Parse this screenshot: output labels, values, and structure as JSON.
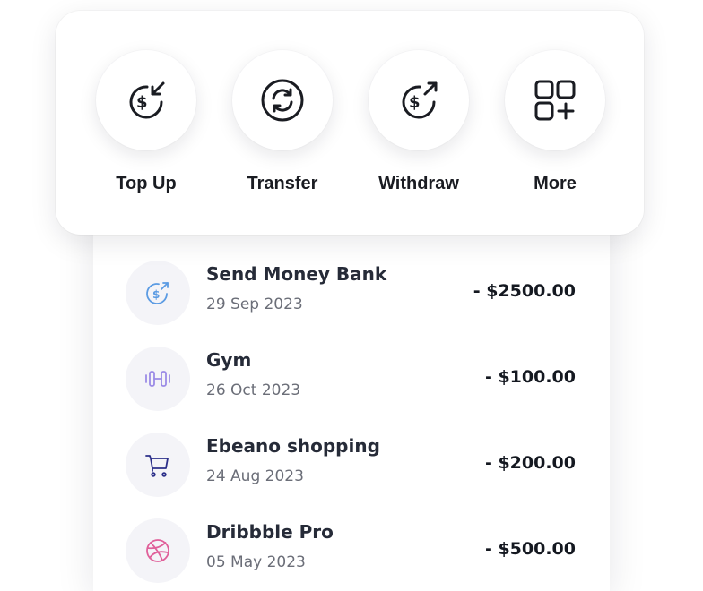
{
  "quick_actions": [
    {
      "label": "Top Up",
      "icon": "dollar-arrow-in-icon"
    },
    {
      "label": "Transfer",
      "icon": "refresh-dollar-icon"
    },
    {
      "label": "Withdraw",
      "icon": "dollar-arrow-out-icon"
    },
    {
      "label": "More",
      "icon": "grid-plus-icon"
    }
  ],
  "transactions": [
    {
      "name": "Send Money Bank",
      "date": "29 Sep 2023",
      "amount": "- $2500.00",
      "icon": "send-money-icon",
      "icon_color": "#5b9be3"
    },
    {
      "name": "Gym",
      "date": "26 Oct 2023",
      "amount": "- $100.00",
      "icon": "dumbbell-icon",
      "icon_color": "#9b8be6"
    },
    {
      "name": "Ebeano shopping",
      "date": "24 Aug 2023",
      "amount": "- $200.00",
      "icon": "shopping-cart-icon",
      "icon_color": "#2c2f8a"
    },
    {
      "name": "Dribbble Pro",
      "date": "05 May 2023",
      "amount": "- $500.00",
      "icon": "dribbble-icon",
      "icon_color": "#e0609a"
    }
  ],
  "colors": {
    "text_primary": "#262b38",
    "text_secondary": "#6b6e78",
    "icon_bg": "#f4f4f8"
  }
}
